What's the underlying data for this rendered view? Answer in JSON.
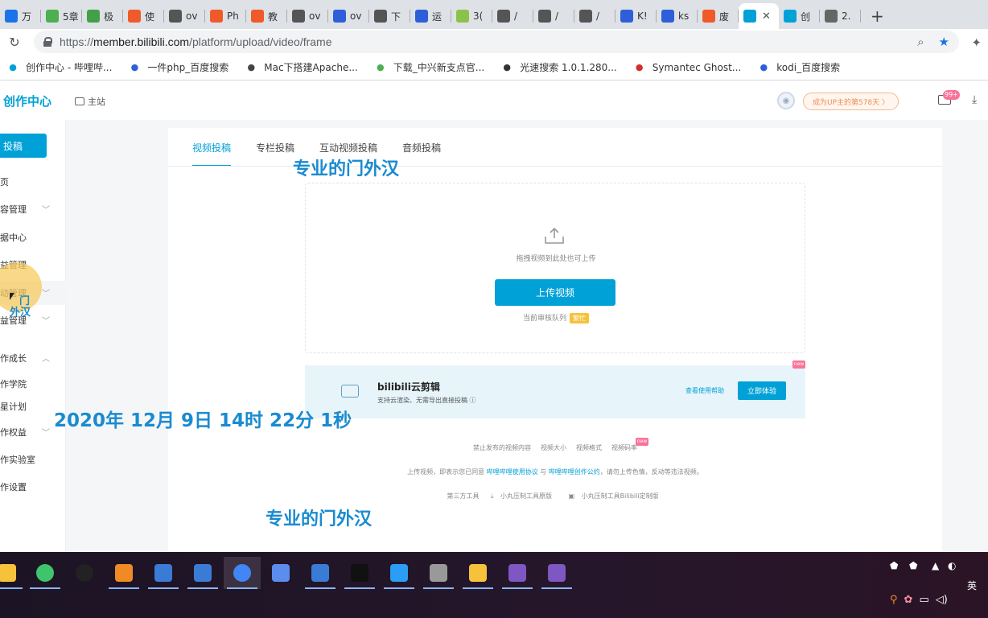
{
  "browser": {
    "tabs": [
      {
        "label": "万",
        "icon": "app-icon",
        "color": "#1a73e8"
      },
      {
        "label": "5章",
        "icon": "book-icon",
        "color": "#4caf50"
      },
      {
        "label": "极",
        "icon": "lr-icon",
        "color": "#43a047"
      },
      {
        "label": "使",
        "icon": "c-icon",
        "color": "#f05a28"
      },
      {
        "label": "ov",
        "icon": "mac-icon",
        "color": "#555555"
      },
      {
        "label": "Ph",
        "icon": "c-icon",
        "color": "#f05a28"
      },
      {
        "label": "教",
        "icon": "c-icon",
        "color": "#f05a28"
      },
      {
        "label": "ov",
        "icon": "globe-icon",
        "color": "#555555"
      },
      {
        "label": "ov",
        "icon": "baidu-icon",
        "color": "#2f5fd8"
      },
      {
        "label": "下",
        "icon": "globe-icon",
        "color": "#555555"
      },
      {
        "label": "运",
        "icon": "baidu-icon",
        "color": "#2f5fd8"
      },
      {
        "label": "3(",
        "icon": "360-icon",
        "color": "#8bc34a"
      },
      {
        "label": "/",
        "icon": "globe-icon",
        "color": "#555555"
      },
      {
        "label": "/",
        "icon": "globe-icon",
        "color": "#555555"
      },
      {
        "label": "/",
        "icon": "globe-icon",
        "color": "#555555"
      },
      {
        "label": "K!",
        "icon": "baidu-icon",
        "color": "#2f5fd8"
      },
      {
        "label": "ks",
        "icon": "baidu-icon",
        "color": "#2f5fd8"
      },
      {
        "label": "废",
        "icon": "c-icon",
        "color": "#f05a28"
      },
      {
        "label": "",
        "icon": "bilibili-icon",
        "color": "#00a1d6",
        "active": true
      },
      {
        "label": "创",
        "icon": "bilibili-icon",
        "color": "#00a1d6"
      },
      {
        "label": "2.",
        "icon": "infinity-icon",
        "color": "#666666"
      }
    ],
    "url_prefix": "https://",
    "url_host": "member.bilibili.com",
    "url_path": "/platform/upload/video/frame",
    "bookmarks": [
      {
        "label": "创作中心 - 哔哩哔...",
        "icon": "bilibili-icon"
      },
      {
        "label": "一件php_百度搜索",
        "icon": "baidu-icon"
      },
      {
        "label": "Mac下搭建Apache...",
        "icon": "mac-icon"
      },
      {
        "label": "下载_中兴新支点官...",
        "icon": "zte-icon"
      },
      {
        "label": "光速搜索 1.0.1.280...",
        "icon": "cursor-icon"
      },
      {
        "label": "Symantec Ghost...",
        "icon": "ghost-icon"
      },
      {
        "label": "kodi_百度搜索",
        "icon": "baidu-icon"
      }
    ]
  },
  "header": {
    "logo": "创作中心",
    "home_link": "主站",
    "up_badge": "成为UP主的第578天 〉",
    "mail_badge": "99+"
  },
  "sidebar": {
    "upload_button": "投稿",
    "items": [
      {
        "label": "页",
        "chevron": false
      },
      {
        "label": "容管理",
        "chevron": true
      },
      {
        "label": "据中心",
        "chevron": false
      },
      {
        "label": "益管理",
        "chevron": false
      },
      {
        "label": "动管理",
        "chevron": true
      },
      {
        "label": "益管理",
        "chevron": true
      },
      {
        "label": "作成长",
        "chevron": true
      },
      {
        "label": "作学院",
        "chevron": false
      },
      {
        "label": "星计划",
        "chevron": false
      },
      {
        "label": "作权益",
        "chevron": true
      },
      {
        "label": "作实验室",
        "chevron": false
      },
      {
        "label": "作设置",
        "chevron": false
      }
    ]
  },
  "main": {
    "tabs": [
      "视频投稿",
      "专栏投稿",
      "互动视频投稿",
      "音频投稿"
    ],
    "drop_hint": "拖拽视频到此处也可上传",
    "upload_button": "上传视频",
    "queue_label": "当前审核队列",
    "queue_status": "繁忙",
    "cloud": {
      "title": "bilibili云剪辑",
      "desc": "支持云渲染、无需导出直接投稿 ⓘ",
      "help": "查看使用帮助",
      "button": "立即体验",
      "new_tag": "new"
    },
    "links": [
      "禁止发布的视频内容",
      "视频大小",
      "视频格式",
      "视频码率"
    ],
    "links_new_tag": "new",
    "terms_prefix": "上传视频，即表示您已同意",
    "terms_link1": "哔哩哔哩使用协议",
    "terms_mid": "与",
    "terms_link2": "哔哩哔哩创作公约",
    "terms_suffix": "，请勿上传色情，反动等违法视频。",
    "tools_label": "第三方工具",
    "tool1": "小丸压制工具原版",
    "tool2": "小丸压制工具Bilibili定制版"
  },
  "overlay": {
    "watermark_top": "专业的门外汉",
    "watermark_bottom": "专业的门外汉",
    "timestamp": "2020年 12月 9日 14时 22分 1秒",
    "cursor_label_line1": "门",
    "cursor_label_line2": "外汉"
  },
  "taskbar": {
    "apps": [
      "folder-icon",
      "globe-icon",
      "media-icon",
      "search-icon",
      "window-icon",
      "window-icon",
      "chrome-icon",
      "network-icon",
      "bird-icon",
      "7zip-icon",
      "monitor-icon",
      "drive-icon",
      "ftp-icon",
      "pentagon-icon",
      "pentagon-icon"
    ],
    "tray_lang": "英"
  }
}
